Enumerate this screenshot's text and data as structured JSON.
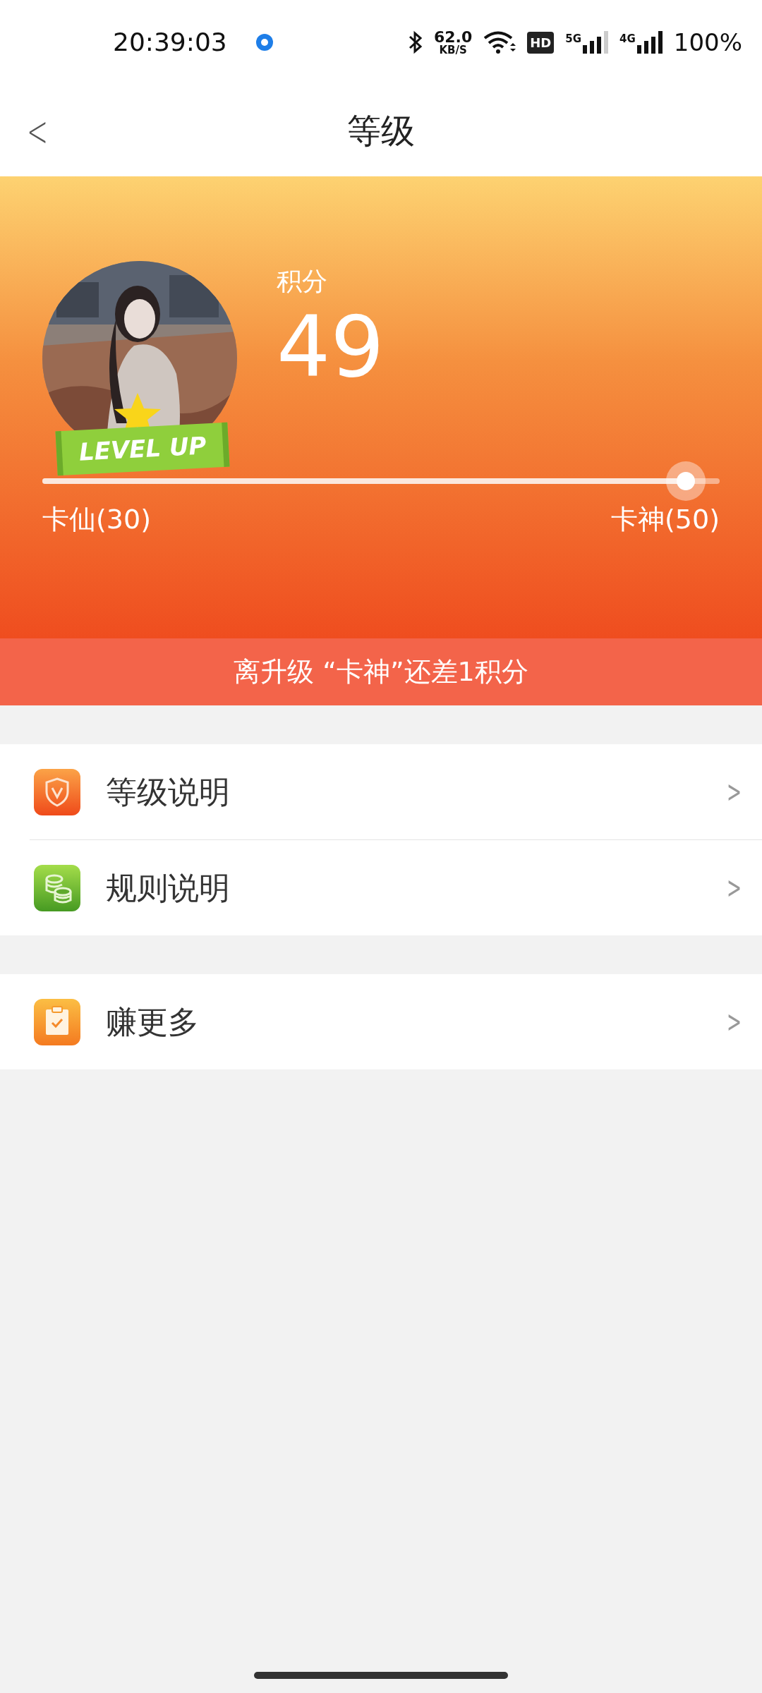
{
  "status_bar": {
    "time": "20:39:03",
    "speed_value": "62.0",
    "speed_unit": "KB/S",
    "hd_label": "HD",
    "sim1_label": "5G",
    "sim2_label": "4G",
    "battery": "100%"
  },
  "header": {
    "back": "<",
    "title": "等级"
  },
  "profile": {
    "badge": "LEVEL UP",
    "points_label": "积分",
    "points": "49",
    "progress": {
      "level": 0.95
    },
    "from_level": "卡仙(30)",
    "to_level": "卡神(50)"
  },
  "notice": "离升级 “卡神”还差1积分",
  "groups": [
    [
      {
        "kind": "shield",
        "label": "等级说明",
        "chevron": ">"
      },
      {
        "kind": "coins",
        "label": "规则说明",
        "chevron": ">"
      }
    ],
    [
      {
        "kind": "clipboard",
        "label": "赚更多",
        "chevron": ">"
      }
    ]
  ]
}
